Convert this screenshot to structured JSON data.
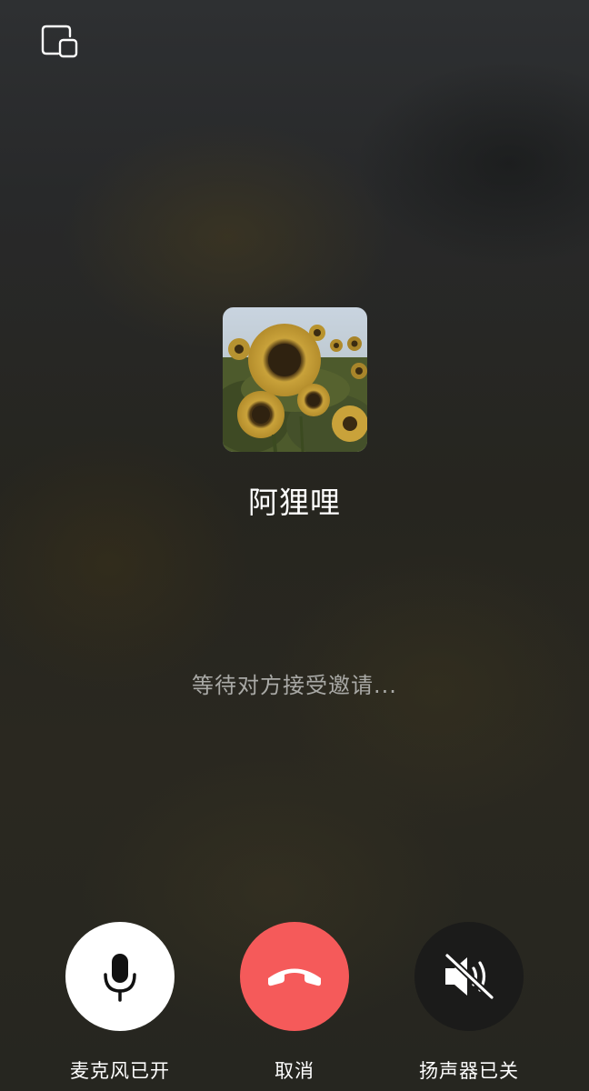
{
  "toolbar": {
    "float_window_icon": "minimize-to-floating-window-icon"
  },
  "caller": {
    "name": "阿狸哩",
    "avatar_icon": "sunflower-avatar"
  },
  "call": {
    "status": "等待对方接受邀请..."
  },
  "controls": {
    "microphone": {
      "label": "麦克风已开",
      "icon": "microphone-icon",
      "state": "on"
    },
    "cancel": {
      "label": "取消",
      "icon": "hang-up-phone-icon",
      "color": "#f55a5a"
    },
    "speaker": {
      "label": "扬声器已关",
      "icon": "speaker-muted-icon",
      "state": "off"
    }
  },
  "colors": {
    "hangup": "#f55a5a",
    "text_primary": "#ffffff",
    "text_secondary": "#a9a9a6"
  }
}
